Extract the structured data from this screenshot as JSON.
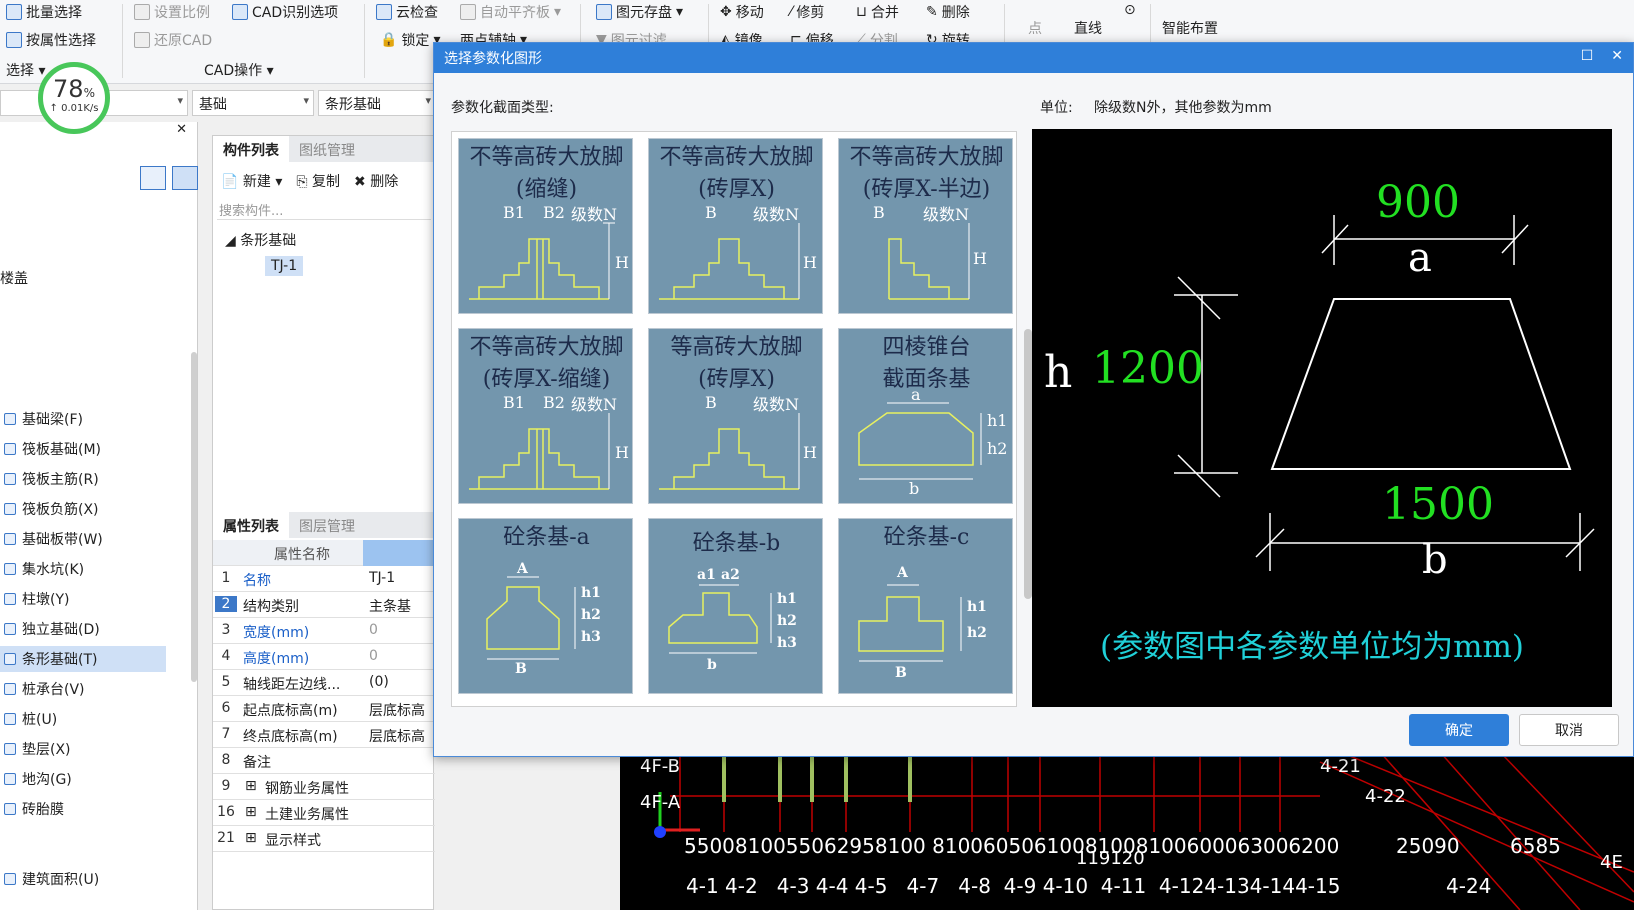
{
  "ribbon": {
    "batch_select": "批量选择",
    "select_by_prop": "按属性选择",
    "select_group": "选择",
    "set_scale": "设置比例",
    "restore_cad": "还原CAD",
    "cad_recognize_options": "CAD识别选项",
    "cad_ops_group": "CAD操作",
    "cloud_check": "云检查",
    "auto_level": "自动平齐板",
    "lock": "锁定",
    "two_point_axis": "两点辅轴",
    "save_element": "图元存盘",
    "element_filter": "图元过滤",
    "move": "移动",
    "trim": "修剪",
    "merge": "合并",
    "delete": "删除",
    "mirror": "镜像",
    "offset": "偏移",
    "split": "分割",
    "rotate": "旋转",
    "point": "点",
    "line": "直线",
    "smart_layout": "智能布置"
  },
  "speed": {
    "percent": "78",
    "unit": "%",
    "rate": "0.01K/s"
  },
  "filters": {
    "floor": "",
    "category": "基础",
    "type": "条形基础"
  },
  "left_nav": {
    "top_label": "楼盖",
    "items": [
      "基础梁(F)",
      "筏板基础(M)",
      "筏板主筋(R)",
      "筏板负筋(X)",
      "基础板带(W)",
      "集水坑(K)",
      "柱墩(Y)",
      "独立基础(D)",
      "条形基础(T)",
      "桩承台(V)",
      "桩(U)",
      "垫层(X)",
      "地沟(G)",
      "砖胎膜"
    ],
    "bottom_item": "建筑面积(U)"
  },
  "component_panel": {
    "tab_list": "构件列表",
    "tab_drawing": "图纸管理",
    "new": "新建",
    "copy": "复制",
    "delete": "删除",
    "search_placeholder": "搜索构件...",
    "tree_root": "条形基础",
    "tree_leaf": "TJ-1"
  },
  "property_panel": {
    "tab_props": "属性列表",
    "tab_layers": "图层管理",
    "header_name": "属性名称",
    "rows": [
      {
        "n": "1",
        "k": "名称",
        "v": "TJ-1"
      },
      {
        "n": "2",
        "k": "结构类别",
        "v": "主条基"
      },
      {
        "n": "3",
        "k": "宽度(mm)",
        "v": "0"
      },
      {
        "n": "4",
        "k": "高度(mm)",
        "v": "0"
      },
      {
        "n": "5",
        "k": "轴线距左边线...",
        "v": "(0)"
      },
      {
        "n": "6",
        "k": "起点底标高(m)",
        "v": "层底标高"
      },
      {
        "n": "7",
        "k": "终点底标高(m)",
        "v": "层底标高"
      },
      {
        "n": "8",
        "k": "备注",
        "v": ""
      },
      {
        "n": "9",
        "k": "钢筋业务属性",
        "v": ""
      },
      {
        "n": "16",
        "k": "土建业务属性",
        "v": ""
      },
      {
        "n": "21",
        "k": "显示样式",
        "v": ""
      }
    ]
  },
  "cad": {
    "dims_row": "5500810055062958100 81006050610081008100600063006200",
    "dims_extra": "25090",
    "dims_extra2": "6585",
    "dims_sub": "119120",
    "axes_row": "4-1 4-2   4-3 4-4 4-5   4-7   4-8  4-9 4-10  4-11  4-124-134-144-15",
    "axis_right": "4-24",
    "labels_left": [
      "4F-B",
      "4F-A"
    ],
    "label_top_right": "4-21",
    "label_right": "4-22",
    "label_4e": "4E"
  },
  "dialog": {
    "title": "选择参数化图形",
    "section_type_label": "参数化截面类型:",
    "unit_label": "单位:",
    "unit_desc": "除级数N外，其他参数为mm",
    "ok": "确定",
    "cancel": "取消",
    "thumbs": [
      {
        "t1": "不等高砖大放脚",
        "t2": "(缩缝)",
        "labs": [
          "B1",
          "B2",
          "级数N",
          "H"
        ]
      },
      {
        "t1": "不等高砖大放脚",
        "t2": "(砖厚X)",
        "labs": [
          "B",
          "级数N",
          "H"
        ]
      },
      {
        "t1": "不等高砖大放脚",
        "t2": "(砖厚X-半边)",
        "labs": [
          "B",
          "级数N",
          "H"
        ]
      },
      {
        "t1": "不等高砖大放脚",
        "t2": "(砖厚X-缩缝)",
        "labs": [
          "B1",
          "B2",
          "级数N",
          "H"
        ]
      },
      {
        "t1": "等高砖大放脚",
        "t2": "(砖厚X)",
        "labs": [
          "B",
          "级数N",
          "H"
        ]
      },
      {
        "t1": "四棱锥台",
        "t2": "截面条基",
        "labs": [
          "a",
          "h1",
          "h2",
          "b"
        ]
      },
      {
        "t1": "砼条基-a",
        "t2": "",
        "labs": [
          "A",
          "h1",
          "h2",
          "h3",
          "B"
        ]
      },
      {
        "t1": "砼条基-b",
        "t2": "",
        "labs": [
          "a1",
          "a2",
          "h1",
          "h2",
          "h3",
          "b"
        ]
      },
      {
        "t1": "砼条基-c",
        "t2": "",
        "labs": [
          "A",
          "h1",
          "h2",
          "B"
        ]
      }
    ],
    "preview": {
      "a_value": "900",
      "a_label": "a",
      "h_label": "h",
      "h_value": "1200",
      "b_value": "1500",
      "b_label": "b",
      "note": "(参数图中各参数单位均为mm)"
    }
  }
}
